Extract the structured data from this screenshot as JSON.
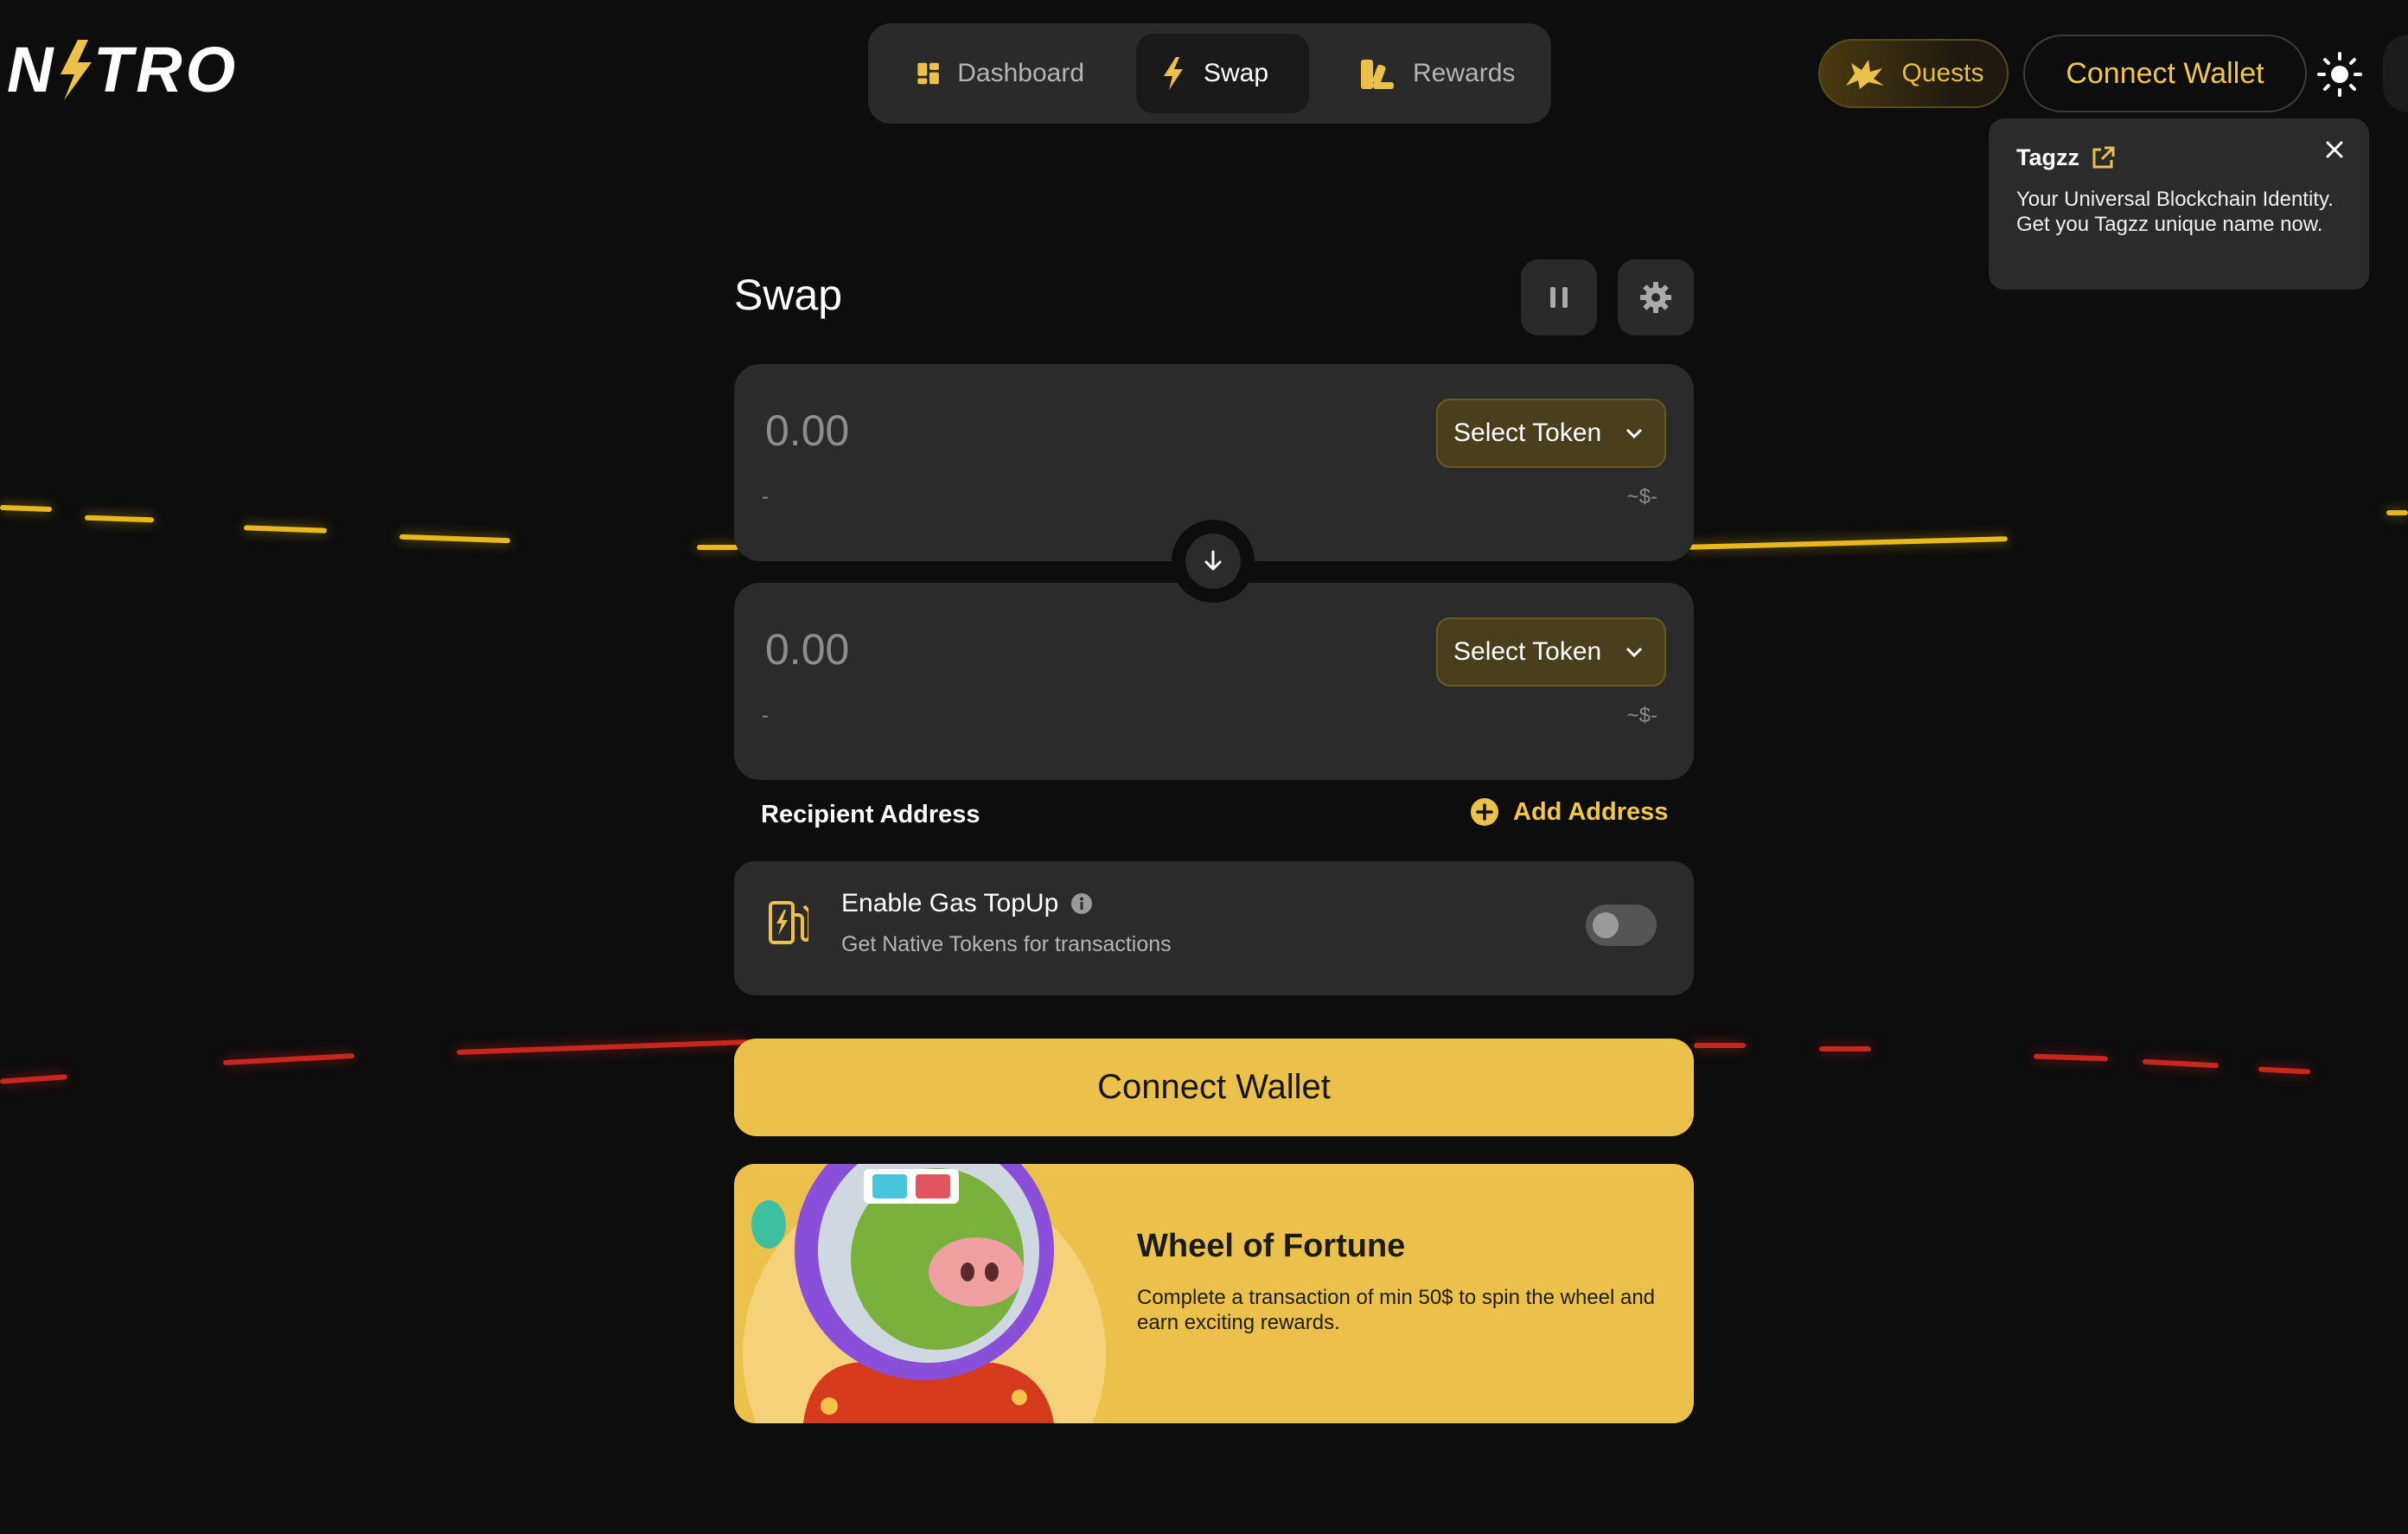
{
  "brand": {
    "logo_text": "NITRO"
  },
  "nav": {
    "items": [
      {
        "label": "Dashboard",
        "icon": "dashboard-icon"
      },
      {
        "label": "Swap",
        "icon": "bolt-icon",
        "active": true
      },
      {
        "label": "Rewards",
        "icon": "rewards-icon"
      }
    ]
  },
  "header": {
    "quests_label": "Quests",
    "connect_label": "Connect Wallet",
    "theme_icon": "sun-icon"
  },
  "tooltip": {
    "title": "Tagzz",
    "body": "Your Universal Blockchain Identity. Get you Tagzz unique name now."
  },
  "swap": {
    "title": "Swap",
    "from": {
      "amount": "0.00",
      "token_label": "Select Token",
      "sub_left": "-",
      "sub_right": "~$-"
    },
    "to": {
      "amount": "0.00",
      "token_label": "Select Token",
      "sub_left": "-",
      "sub_right": "~$-"
    },
    "recipient_label": "Recipient Address",
    "add_address_label": "Add Address",
    "gas": {
      "title": "Enable Gas TopUp",
      "subtitle": "Get Native Tokens for transactions",
      "enabled": false
    },
    "connect_label": "Connect Wallet"
  },
  "promo": {
    "title": "Wheel of Fortune",
    "description": "Complete a transaction of min 50$ to spin the wheel and earn exciting rewards."
  },
  "colors": {
    "accent": "#EBC14C",
    "background": "#0D0D0D",
    "card": "#2B2B2B"
  }
}
